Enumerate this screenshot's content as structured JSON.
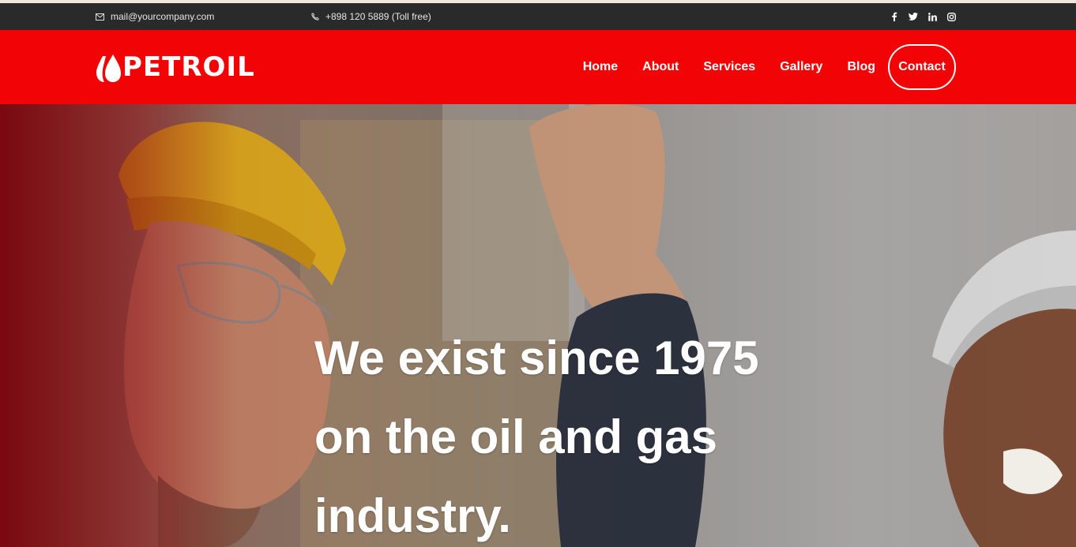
{
  "topbar": {
    "email": "mail@yourcompany.com",
    "phone": "+898 120 5889 (Toll free)",
    "social": [
      {
        "name": "facebook",
        "glyph": "f"
      },
      {
        "name": "twitter",
        "glyph": "t"
      },
      {
        "name": "linkedin",
        "glyph": "in"
      },
      {
        "name": "instagram",
        "glyph": "ig"
      }
    ]
  },
  "header": {
    "logo_text": "PETROIL",
    "nav": {
      "home": "Home",
      "about": "About",
      "services": "Services",
      "gallery": "Gallery",
      "blog": "Blog",
      "contact": "Contact"
    }
  },
  "hero": {
    "title_lines": [
      "We exist since 1975",
      "on the oil and gas",
      "industry."
    ]
  },
  "colors": {
    "brand_red": "#f20305",
    "topbar_bg": "#2a2a2a",
    "text_white": "#ffffff"
  },
  "icons": {
    "mail": "mail-icon",
    "phone": "phone-icon",
    "logo": "oil-drop-icon"
  }
}
